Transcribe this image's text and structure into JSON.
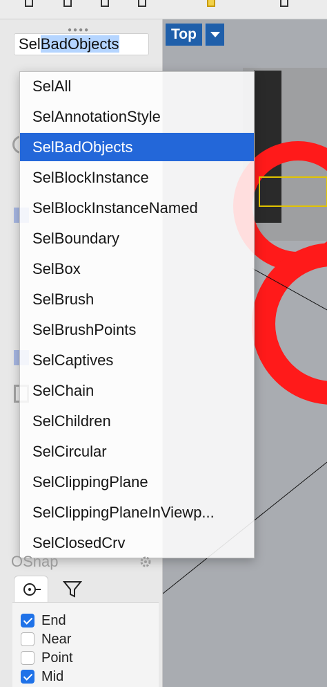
{
  "toolbar": {
    "icons": [
      "array-icon",
      "grid-icon",
      "layout-icon",
      "dimension-icon",
      "render-icon",
      "snapshot-icon"
    ]
  },
  "command": {
    "prefix": "Sel",
    "selected": "BadObjects"
  },
  "viewport": {
    "label": "Top"
  },
  "menu": {
    "items": [
      "SelAll",
      "SelAnnotationStyle",
      "SelBadObjects",
      "SelBlockInstance",
      "SelBlockInstanceNamed",
      "SelBoundary",
      "SelBox",
      "SelBrush",
      "SelBrushPoints",
      "SelCaptives",
      "SelChain",
      "SelChildren",
      "SelCircular",
      "SelClippingPlane",
      "SelClippingPlaneInViewp...",
      "SelClosedCrv"
    ],
    "selected_index": 2
  },
  "osnap": {
    "title": "OSnap",
    "tabs": [
      "osnap-icon",
      "filter-icon"
    ],
    "options": [
      {
        "label": "End",
        "checked": true
      },
      {
        "label": "Near",
        "checked": false
      },
      {
        "label": "Point",
        "checked": false
      },
      {
        "label": "Mid",
        "checked": true
      }
    ]
  },
  "colors": {
    "accent": "#2367d9",
    "viewport_label": "#1f5faa",
    "geometry": "#ff1a1a"
  }
}
